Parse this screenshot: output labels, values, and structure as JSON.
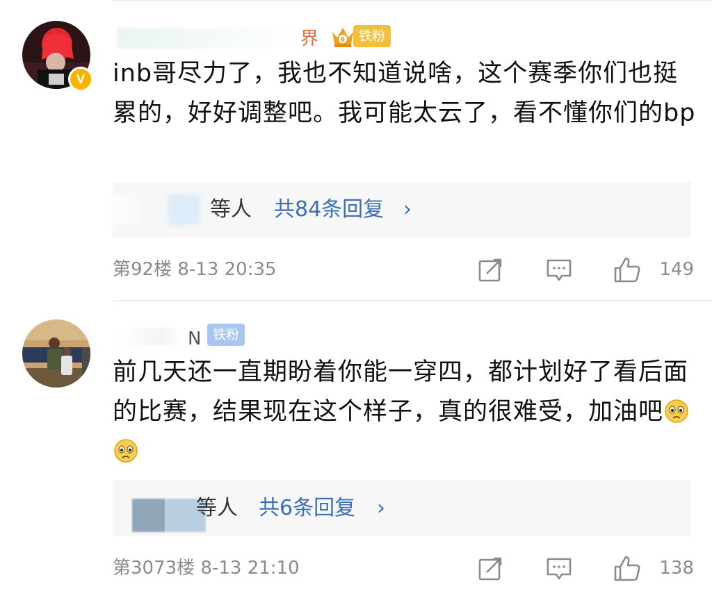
{
  "comments": [
    {
      "username_tail": "界",
      "fan_badge": "铁粉",
      "text": "inb哥尽力了，我也不知道说啥，这个赛季你们也挺累的，好好调整吧。我可能太云了，看不懂你们的bp",
      "reply_who": "等人",
      "reply_count": "共84条回复",
      "reply_chevron": "›",
      "floor_time": "第92楼  8-13 20:35",
      "likes": "149",
      "verified_mark": "V",
      "icons": [
        "share-icon",
        "comment-icon",
        "like-icon"
      ]
    },
    {
      "username_tail": "N",
      "fan_badge": "铁粉",
      "text": "前几天还一直期盼着你能一穿四，都计划好了看后面的比赛，结果现在这个样子，真的很难受，加油吧",
      "reply_who": "等人",
      "reply_count": "共6条回复",
      "reply_chevron": "›",
      "floor_time": "第3073楼  8-13 21:10",
      "likes": "138",
      "icons": [
        "share-icon",
        "comment-icon",
        "like-icon"
      ]
    }
  ],
  "colors": {
    "link": "#3b6fb6",
    "meta": "#8a8a8a",
    "reply_bg": "#f7f7f7",
    "fan_badge": "#a7c6f0",
    "verified": "#f7b500"
  }
}
